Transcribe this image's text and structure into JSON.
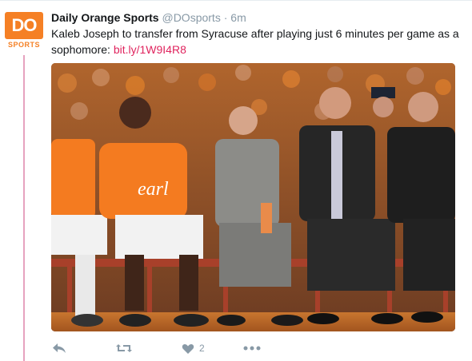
{
  "account": {
    "logo_text": "DO",
    "logo_subtext": "SPORTS",
    "name": "Daily Orange Sports",
    "handle": "@DOsports",
    "separator": "·",
    "time": "6m"
  },
  "tweet": {
    "text": "Kaleb Joseph to transfer from Syracuse after playing just 6 minutes per game as a sophomore: ",
    "link": "bit.ly/1W9I4R8",
    "like_count": "2"
  },
  "jersey_text": "earl",
  "icons": [
    "reply-icon",
    "retweet-icon",
    "like-icon",
    "more-icon"
  ],
  "colors": {
    "brand_orange": "#f58025",
    "link": "#e0245e",
    "muted": "#8899a6",
    "thread_line": "#e6a2bf"
  }
}
